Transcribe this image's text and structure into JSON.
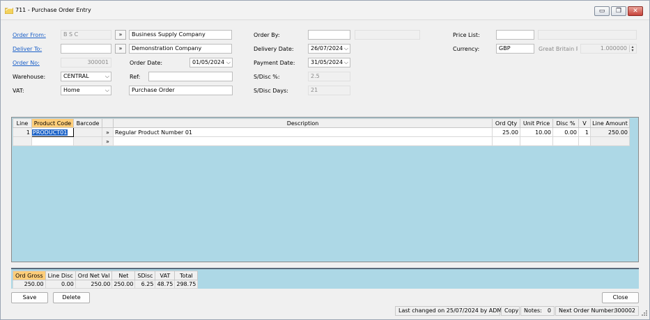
{
  "window": {
    "title": "711 - Purchase Order Entry",
    "controls": {
      "minimize": "▭",
      "restore": "❐",
      "close": "✕"
    }
  },
  "header": {
    "order_from": {
      "label": "Order From:",
      "code": "B S C",
      "name": "Business Supply Company"
    },
    "deliver_to": {
      "label": "Deliver To:",
      "code": "",
      "name": "Demonstration Company"
    },
    "order_no": {
      "label": "Order No:",
      "value": "300001"
    },
    "warehouse": {
      "label": "Warehouse:",
      "value": "CENTRAL"
    },
    "vat": {
      "label": "VAT:",
      "value": "Home"
    },
    "order_date": {
      "label": "Order Date:",
      "value": "01/05/2024"
    },
    "ref": {
      "label": "Ref:",
      "value": ""
    },
    "doc_type": {
      "value": "Purchase Order"
    },
    "order_by": {
      "label": "Order By:",
      "value": ""
    },
    "delivery_date": {
      "label": "Delivery Date:",
      "value": "26/07/2024"
    },
    "payment_date": {
      "label": "Payment Date:",
      "value": "31/05/2024"
    },
    "sdisc_pct": {
      "label": "S/Disc %:",
      "value": "2.5"
    },
    "sdisc_days": {
      "label": "S/Disc Days:",
      "value": "21"
    },
    "price_list": {
      "label": "Price List:",
      "value": ""
    },
    "currency": {
      "label": "Currency:",
      "code": "GBP",
      "name": "Great Britain Pou",
      "rate": "1.000000"
    },
    "picker_glyph": "»"
  },
  "grid": {
    "columns": [
      "Line",
      "Product Code",
      "Barcode",
      "",
      "Description",
      "Ord Qty",
      "Unit Price",
      "Disc %",
      "V",
      "Line Amount"
    ],
    "rows": [
      {
        "line": "1",
        "product_code": "PRODUCT01",
        "barcode": "",
        "btn": "»",
        "description": "Regular Product Number 01",
        "ord_qty": "25.00",
        "unit_price": "10.00",
        "disc": "0.00",
        "v": "1",
        "line_amount": "250.00"
      },
      {
        "line": "",
        "product_code": "",
        "barcode": "",
        "btn": "»",
        "description": "",
        "ord_qty": "",
        "unit_price": "",
        "disc": "",
        "v": "",
        "line_amount": ""
      }
    ]
  },
  "totals": {
    "headers": [
      "Ord Gross",
      "Line Disc",
      "Ord Net Val",
      "Net",
      "SDisc",
      "VAT",
      "Total"
    ],
    "values": [
      "250.00",
      "0.00",
      "250.00",
      "250.00",
      "6.25",
      "48.75",
      "298.75"
    ]
  },
  "buttons": {
    "save": "Save",
    "delete": "Delete",
    "close": "Close"
  },
  "status": {
    "last_changed": "Last changed on 25/07/2024 by ADM",
    "copy": "Copy",
    "notes_label": "Notes:",
    "notes_count": "0",
    "next_order_label": "Next Order Number:",
    "next_order_value": "300002"
  },
  "colors": {
    "grid_bg": "#add8e6",
    "active_header": "#ffce7a",
    "link": "#1a5fc8",
    "selection": "#1e64c8"
  }
}
